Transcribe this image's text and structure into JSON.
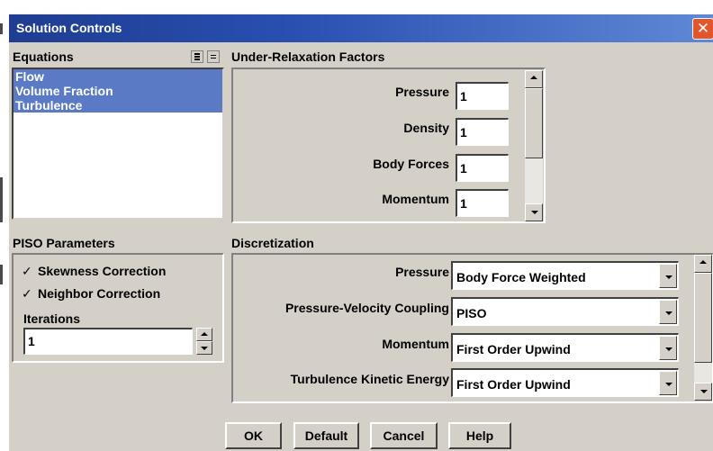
{
  "window": {
    "title": "Solution Controls",
    "close_glyph": "✕"
  },
  "equations": {
    "label": "Equations",
    "items": [
      "Flow",
      "Volume Fraction",
      "Turbulence"
    ]
  },
  "urf": {
    "label": "Under-Relaxation Factors",
    "fields": [
      {
        "label": "Pressure",
        "value": "1"
      },
      {
        "label": "Density",
        "value": "1"
      },
      {
        "label": "Body Forces",
        "value": "1"
      },
      {
        "label": "Momentum",
        "value": "1"
      }
    ]
  },
  "piso": {
    "label": "PISO Parameters",
    "skewness": {
      "label": "Skewness Correction",
      "checked": true
    },
    "neighbor": {
      "label": "Neighbor Correction",
      "checked": true
    },
    "iterations": {
      "label": "Iterations",
      "value": "1"
    }
  },
  "discretization": {
    "label": "Discretization",
    "rows": [
      {
        "label": "Pressure",
        "value": "Body Force Weighted"
      },
      {
        "label": "Pressure-Velocity Coupling",
        "value": "PISO"
      },
      {
        "label": "Momentum",
        "value": "First Order Upwind"
      },
      {
        "label": "Turbulence Kinetic Energy",
        "value": "First Order Upwind"
      }
    ]
  },
  "buttons": {
    "ok": "OK",
    "default": "Default",
    "cancel": "Cancel",
    "help": "Help"
  },
  "check_glyph": "✓"
}
